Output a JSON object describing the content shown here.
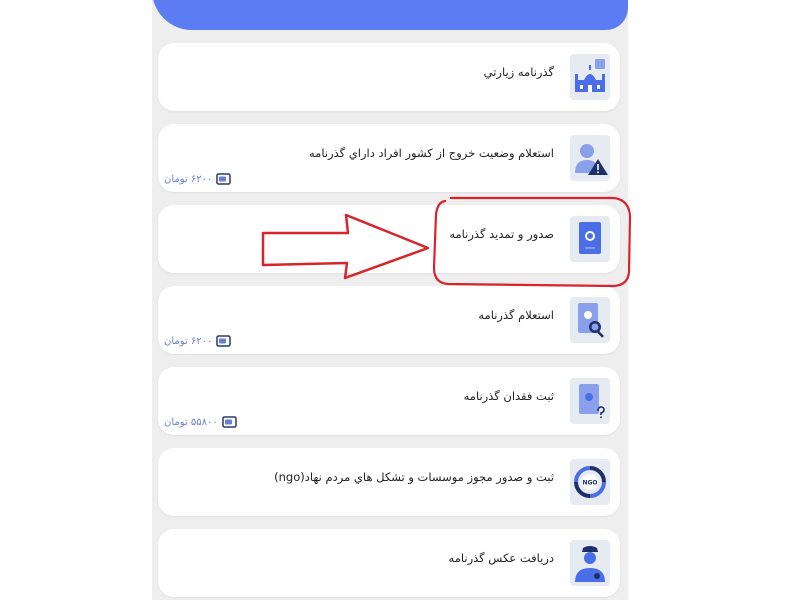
{
  "colors": {
    "accent": "#5b7cf3",
    "annotation": "#d9242b",
    "price_text": "#6b7fd6"
  },
  "services": [
    {
      "title": "گذرنامه زيارتي",
      "icon": "mosque-icon",
      "price": null
    },
    {
      "title": "استعلام وضعيت خروج از كشور افراد داراي گذرنامه",
      "icon": "user-warning-icon",
      "price": "۶۲۰۰ تومان"
    },
    {
      "title": "صدور و تمديد گذرنامه",
      "icon": "passport-icon",
      "price": null
    },
    {
      "title": "استعلام گذرنامه",
      "icon": "passport-search-icon",
      "price": "۶۲۰۰ تومان"
    },
    {
      "title": "ثبت فقدان گذرنامه",
      "icon": "passport-question-icon",
      "price": "۵۵۸۰۰ تومان"
    },
    {
      "title": "ثبت و صدور مجوز موسسات و تشكل هاي مردم نهاد(ngo)",
      "icon": "ngo-icon",
      "price": null
    },
    {
      "title": "دريافت عكس گذرنامه",
      "icon": "police-officer-icon",
      "price": null
    }
  ],
  "annotation": {
    "highlight": "arrow-and-circle",
    "target_index": 2
  },
  "icon_text": {
    "ngo": "NGO"
  }
}
